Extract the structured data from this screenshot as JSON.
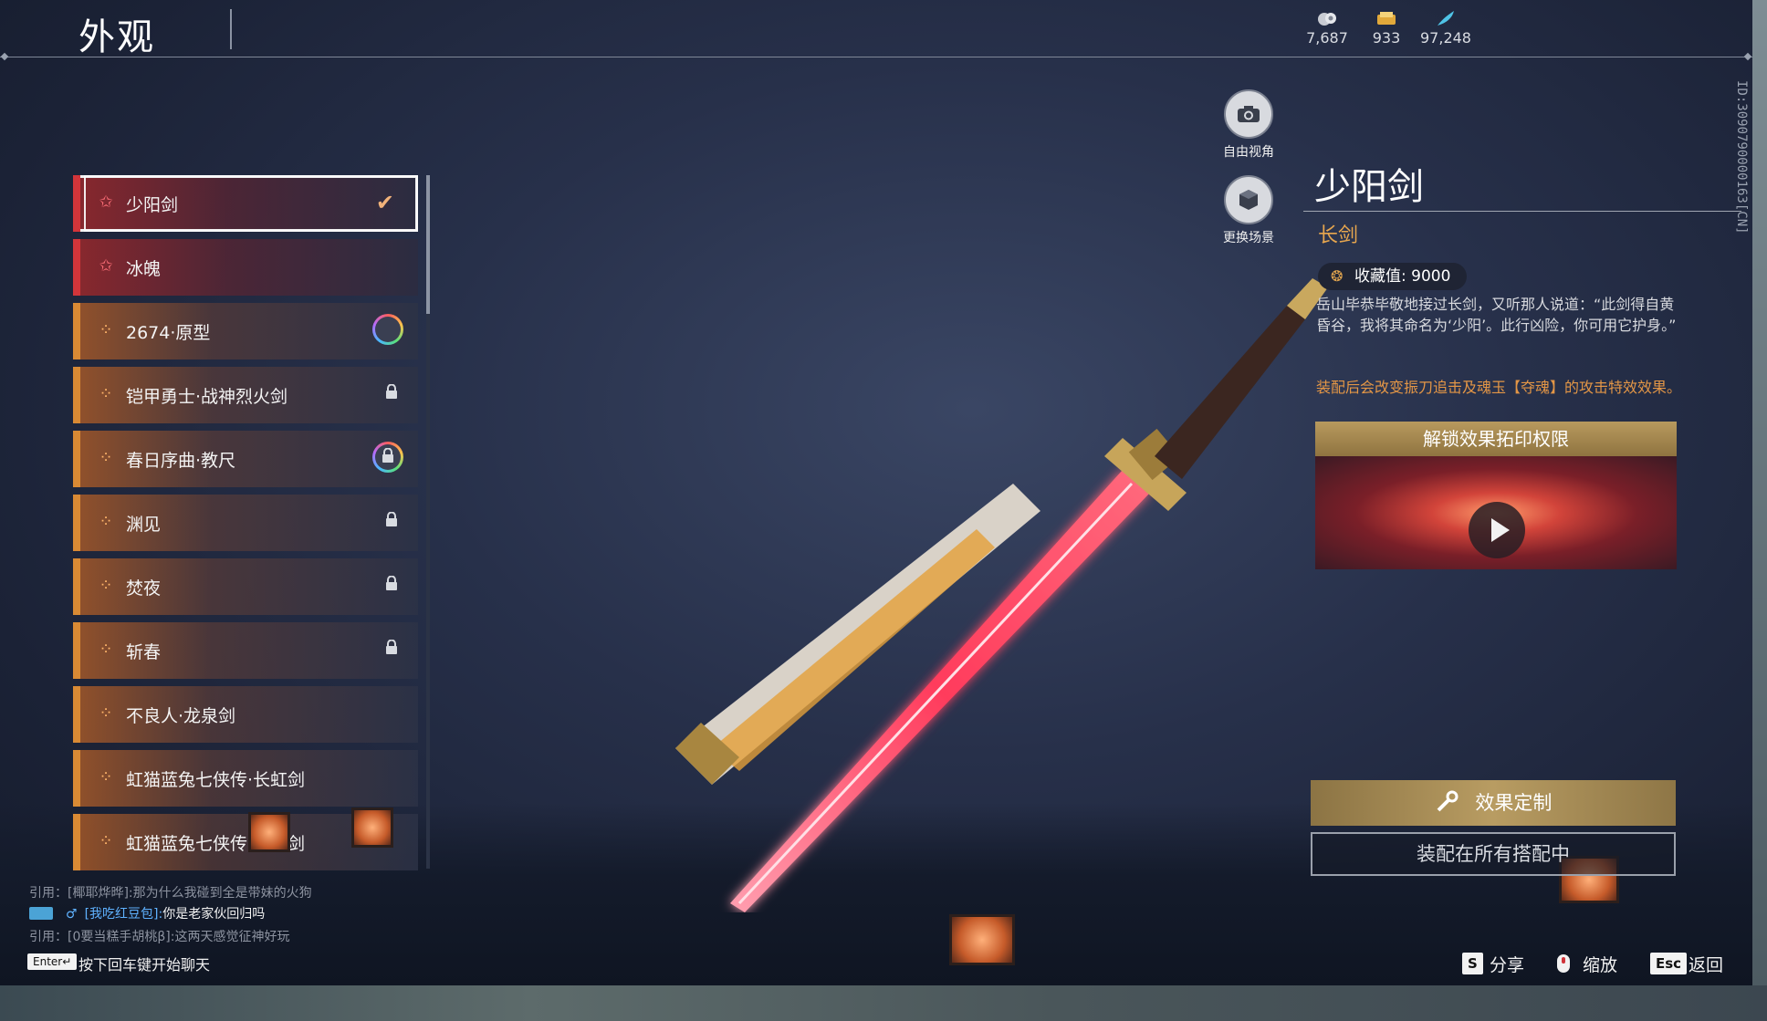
{
  "header": {
    "title": "外观"
  },
  "currencies": [
    {
      "icon": "cloud-coin-icon",
      "value": "7,687"
    },
    {
      "icon": "ticket-icon",
      "value": "933"
    },
    {
      "icon": "feather-icon",
      "value": "97,248"
    }
  ],
  "tools": [
    {
      "icon": "camera-icon",
      "label": "自由视角"
    },
    {
      "icon": "scene-icon",
      "label": "更换场景"
    }
  ],
  "list": {
    "items": [
      {
        "label": "少阳剑",
        "rarity": "red",
        "status": "equipped"
      },
      {
        "label": "冰魄",
        "rarity": "red",
        "status": ""
      },
      {
        "label": "2674·原型",
        "rarity": "gold",
        "status": "ring"
      },
      {
        "label": "铠甲勇士·战神烈火剑",
        "rarity": "gold",
        "status": "locked"
      },
      {
        "label": "春日序曲·教尺",
        "rarity": "gold",
        "status": "ring-locked"
      },
      {
        "label": "渊见",
        "rarity": "gold",
        "status": "locked"
      },
      {
        "label": "焚夜",
        "rarity": "gold",
        "status": "locked"
      },
      {
        "label": "斩春",
        "rarity": "gold",
        "status": "locked"
      },
      {
        "label": "不良人·龙泉剑",
        "rarity": "gold",
        "status": ""
      },
      {
        "label": "虹猫蓝兔七侠传·长虹剑",
        "rarity": "gold",
        "status": ""
      },
      {
        "label": "虹猫蓝兔七侠传·冰魄剑",
        "rarity": "gold",
        "status": ""
      }
    ]
  },
  "detail": {
    "name": "少阳剑",
    "type": "长剑",
    "collect_label": "收藏值: 9000",
    "description": "岳山毕恭毕敬地接过长剑，又听那人说道：“此剑得自黄昏谷，我将其命名为‘少阳’。此行凶险，你可用它护身。”",
    "effect": "装配后会改变振刀追击及魂玉【夺魂】的攻击特效效果。",
    "unlock_title": "解锁效果拓印权限",
    "custom_button": "效果定制",
    "equip_button": "装配在所有搭配中"
  },
  "vertical_id": "ID:3090790000163[CN]",
  "chat": {
    "quote1": "引用：[椰耶烨晔]:那为什么我碰到全是带妹的火狗",
    "speaker": "[我吃红豆包]:",
    "message": "你是老家伙回归吗",
    "quote2": "引用：[0要当糕手胡桃β]:这两天感觉征神好玩",
    "enter_key": "Enter↵",
    "hint": "按下回车键开始聊天"
  },
  "footer": {
    "share_key": "S",
    "share_label": "分享",
    "zoom_label": "缩放",
    "back_key": "Esc",
    "back_label": "返回"
  },
  "colors": {
    "gold_rarity": "#d98a34",
    "red_rarity": "#d2353a",
    "accent_orange": "#e39646"
  }
}
